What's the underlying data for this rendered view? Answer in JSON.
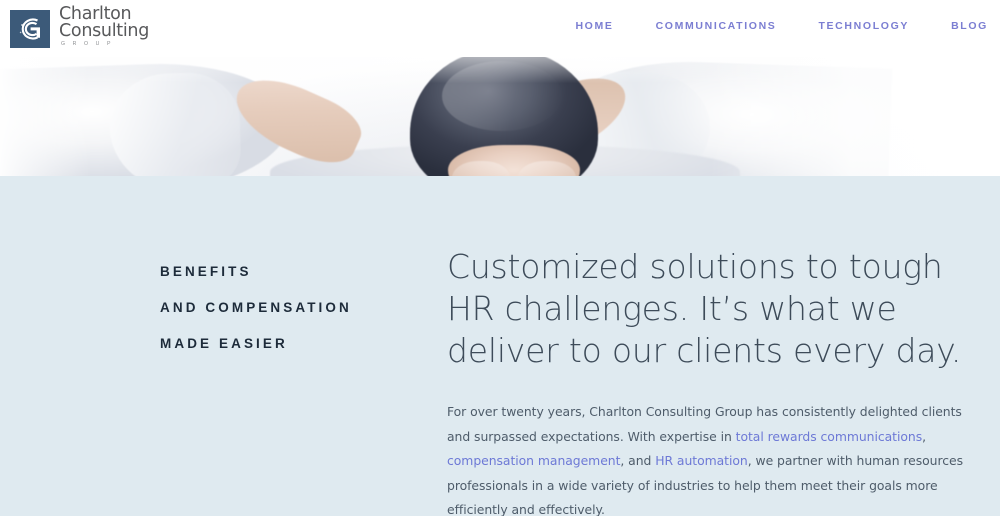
{
  "site": {
    "background_color": "#dfeaf0",
    "header_background": "#ffffff"
  },
  "header": {
    "logo": {
      "mark_icon": "charlton-g-swirl-icon",
      "mark_color": "#3c5a79",
      "name_line_1": "Charlton",
      "name_line_2": "Consulting",
      "tagline": "GROUP",
      "text_color": "#58595b"
    },
    "nav": {
      "link_color": "#7b7ed2",
      "items": [
        {
          "label": "HOME",
          "name": "nav-home"
        },
        {
          "label": "COMMUNICATIONS",
          "name": "nav-communications"
        },
        {
          "label": "TECHNOLOGY",
          "name": "nav-technology"
        },
        {
          "label": "BLOG",
          "name": "nav-blog"
        }
      ]
    }
  },
  "hero": {
    "alt": "Man seen from behind relaxing with hands clasped behind his head, wearing a white shirt on a bright white background"
  },
  "main": {
    "kicker": {
      "color": "#1d2b3a",
      "lines": [
        "BENEFITS",
        "AND COMPENSATION",
        "MADE EASIER"
      ]
    },
    "heading": "Customized solutions to tough HR challenges. It’s what we deliver to our clients every day.",
    "heading_color": "#3d4b59",
    "paragraph": {
      "color": "#4e5c6a",
      "link_color": "#6d79d6",
      "part_1": "For over twenty years, Charlton Consulting Group has consistently delighted clients and surpassed expectations. With expertise in ",
      "link_1": "total rewards communications",
      "part_2": ", ",
      "link_2": "compensation management",
      "part_3": ", and ",
      "link_3": "HR automation",
      "part_4": ", we partner with human resources professionals in a wide variety of industries to help them meet their goals more efficiently and effectively."
    }
  }
}
